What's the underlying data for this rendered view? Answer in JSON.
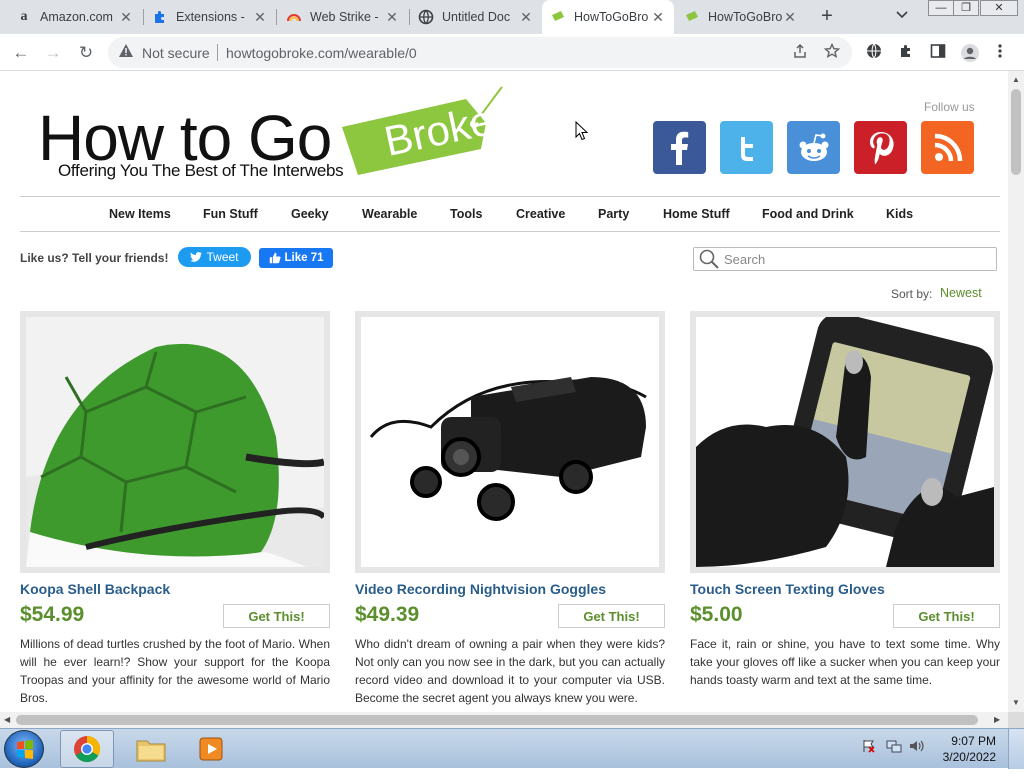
{
  "browser": {
    "tabs": [
      {
        "label": "Amazon.com",
        "icon": "amazon-icon",
        "active": false
      },
      {
        "label": "Extensions -",
        "icon": "puzzle-icon",
        "active": false
      },
      {
        "label": "Web Strike -",
        "icon": "rainbow-icon",
        "active": false
      },
      {
        "label": "Untitled Doc",
        "icon": "globe-icon",
        "active": false
      },
      {
        "label": "HowToGoBro",
        "icon": "tag-icon",
        "active": true
      },
      {
        "label": "HowToGoBro",
        "icon": "tag-icon",
        "active": false
      }
    ],
    "close_glyph": "✕",
    "new_tab_glyph": "+",
    "window_buttons": {
      "minimize": "—",
      "maximize": "❐",
      "close": "✕"
    },
    "toolbar": {
      "back": "←",
      "forward": "→",
      "reload": "↻",
      "security_label": "Not secure",
      "url": "howtogobroke.com/wearable/0"
    }
  },
  "site": {
    "logo_main": "How to Go",
    "logo_broke": "Broke",
    "logo_sub": "Offering You The Best of The Interwebs",
    "follow_label": "Follow us",
    "social": [
      {
        "name": "facebook",
        "glyph": "f",
        "color": "#3b5998"
      },
      {
        "name": "twitter",
        "glyph": "t",
        "color": "#4cb2e9"
      },
      {
        "name": "reddit",
        "glyph": "r",
        "color": "#4a90d9"
      },
      {
        "name": "pinterest",
        "glyph": "P",
        "color": "#cb2027"
      },
      {
        "name": "rss",
        "glyph": "rss",
        "color": "#f26522"
      }
    ],
    "nav": [
      "New Items",
      "Fun Stuff",
      "Geeky",
      "Wearable",
      "Tools",
      "Creative",
      "Party",
      "Home Stuff",
      "Food and Drink",
      "Kids"
    ],
    "like_text": "Like us? Tell your friends!",
    "tweet_label": "Tweet",
    "fb_like_label": "Like 71",
    "search_placeholder": "Search",
    "sort_label": "Sort by:",
    "sort_value": "Newest",
    "get_label": "Get This!",
    "products": [
      {
        "title": "Koopa Shell Backpack",
        "price": "$54.99",
        "desc": "Millions of dead turtles crushed by the foot of Mario. When will he ever learn!? Show your support for the Koopa Troopas and your affinity for the awesome world of Mario Bros."
      },
      {
        "title": "Video Recording Nightvision Goggles",
        "price": "$49.39",
        "desc": "Who didn't dream of owning a pair when they were kids? Not only can you now see in the dark, but you can actually record video and download it to your computer via USB. Become the secret agent you always knew you were."
      },
      {
        "title": "Touch Screen Texting Gloves",
        "price": "$5.00",
        "desc": "Face it, rain or shine, you have to text some time. Why take your gloves off like a sucker when you can keep your hands toasty warm and text at the same time."
      }
    ]
  },
  "taskbar": {
    "time": "9:07 PM",
    "date": "3/20/2022"
  }
}
